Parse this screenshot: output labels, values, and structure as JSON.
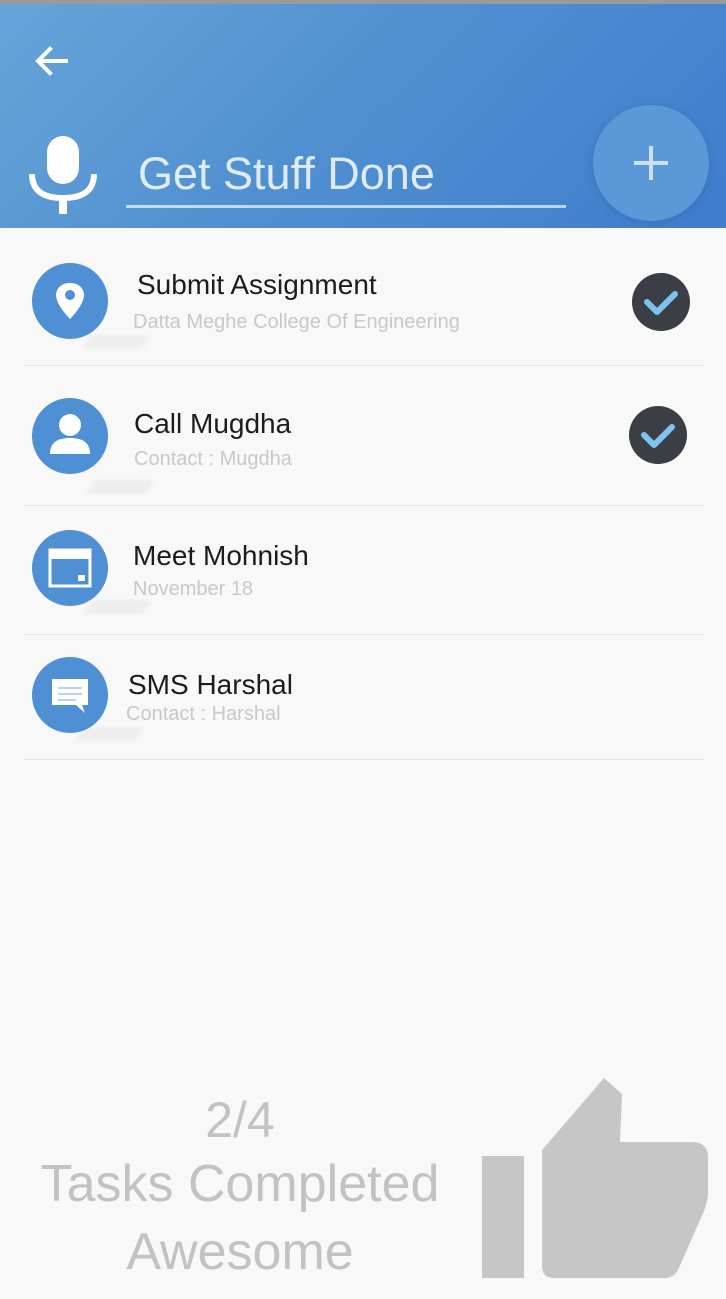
{
  "header": {
    "title_value": "Get Stuff Done",
    "back_icon": "arrow-left-icon",
    "mic_icon": "microphone-icon",
    "add_icon": "plus-icon",
    "gradient_start": "#66a4d8",
    "gradient_end": "#3f7ccd"
  },
  "tasks": [
    {
      "title": "Submit Assignment",
      "subtitle": "Datta Meghe College Of Engineering",
      "icon": "location-pin-icon",
      "completed": true
    },
    {
      "title": "Call Mugdha",
      "subtitle": "Contact : Mugdha",
      "icon": "person-icon",
      "completed": true
    },
    {
      "title": "Meet Mohnish",
      "subtitle": "November 18",
      "icon": "calendar-icon",
      "completed": false
    },
    {
      "title": "SMS Harshal",
      "subtitle": "Contact : Harshal",
      "icon": "message-icon",
      "completed": false
    }
  ],
  "summary": {
    "count": "2/4",
    "label": "Tasks Completed",
    "praise": "Awesome",
    "icon": "thumbs-up-icon"
  },
  "colors": {
    "accent": "#4f8fd3",
    "check_bg": "#3b3f45",
    "check_mark": "#7ec3ef",
    "summary_text": "#c2c2c2"
  }
}
